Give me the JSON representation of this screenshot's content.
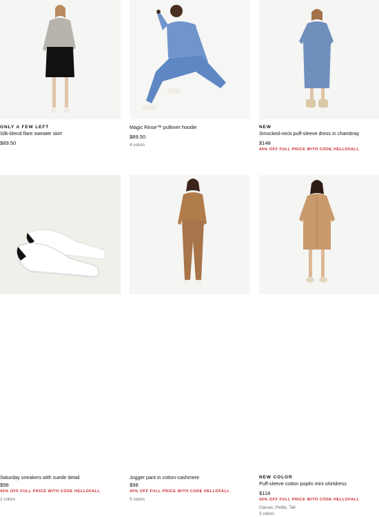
{
  "products": [
    {
      "tag": "ONLY A FEW LEFT",
      "name": "Silk-blend flare sweater skirt",
      "price": "$89.50",
      "promo": "",
      "variants": "",
      "colors": "",
      "bg": "#f5f5f3"
    },
    {
      "tag": "",
      "name": "Magic Rinse™ pullover hoodie",
      "price": "$89.50",
      "promo": "",
      "variants": "",
      "colors": "4 colors",
      "bg": "#f6f6f4"
    },
    {
      "tag": "NEW",
      "name": "Smocked-neck puff-sleeve dress in chambray",
      "price": "$148",
      "promo": "40% OFF FULL PRICE WITH CODE HELLOFALL",
      "variants": "",
      "colors": "",
      "bg": "#f5f5f3"
    },
    {
      "tag": "",
      "name": "Saturday sneakers with suede detail",
      "price": "$98",
      "promo": "40% OFF FULL PRICE WITH CODE HELLOFALL",
      "variants": "",
      "colors": "2 colors",
      "bg": "#f1efea"
    },
    {
      "tag": "",
      "name": "Jogger pant in cotton-cashmere",
      "price": "$98",
      "promo": "40% OFF FULL PRICE WITH CODE HELLOFALL",
      "variants": "",
      "colors": "5 colors",
      "bg": "#f5f5f3"
    },
    {
      "tag": "NEW COLOR",
      "name": "Puff-sleeve cotton poplin mini shirtdress",
      "price": "$118",
      "promo": "40% OFF FULL PRICE WITH CODE HELLOFALL",
      "variants": "Classic, Petite, Tall",
      "colors": "3 colors",
      "bg": "#f5f5f3"
    }
  ],
  "colors": {
    "promo": "#c8262c",
    "meta": "#666666"
  }
}
